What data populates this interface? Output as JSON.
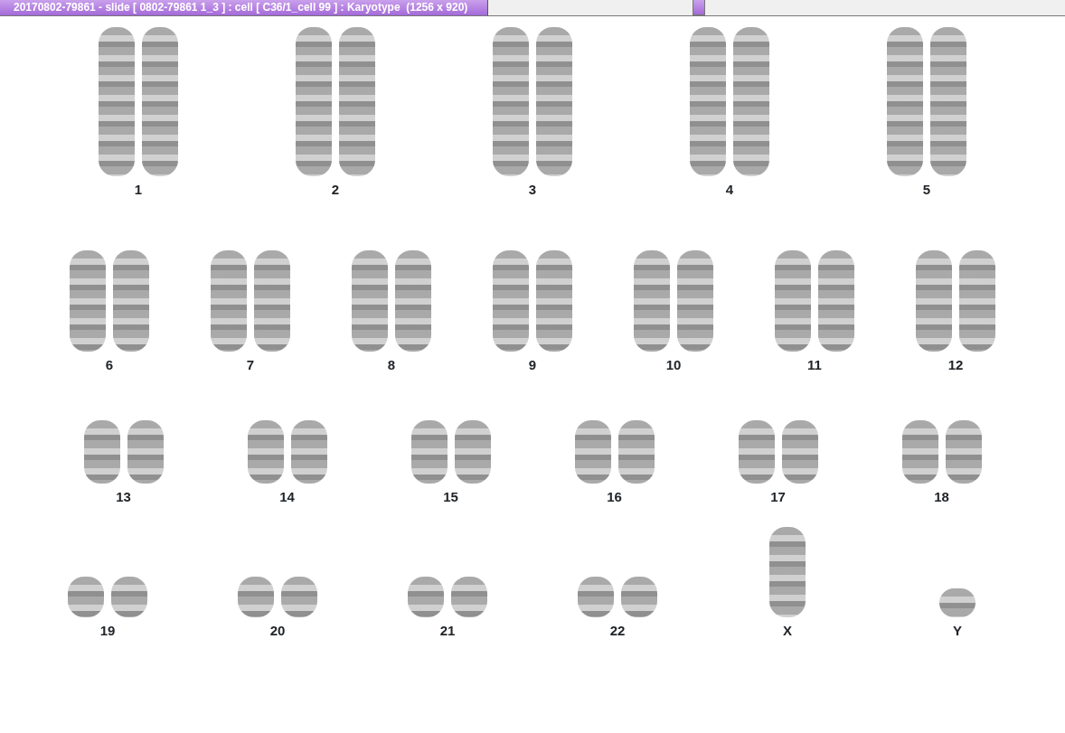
{
  "window": {
    "title": "20170802-79861 - slide [ 0802-79861 1_3 ] : cell [ C36/1_cell 99 ] : Karyotype  (1256 x 920)"
  },
  "karyotype": {
    "rows": [
      {
        "groups": [
          {
            "label": "1",
            "kind": "pair"
          },
          {
            "label": "2",
            "kind": "pair"
          },
          {
            "label": "3",
            "kind": "pair"
          },
          {
            "label": "4",
            "kind": "pair"
          },
          {
            "label": "5",
            "kind": "pair"
          }
        ]
      },
      {
        "groups": [
          {
            "label": "6",
            "kind": "pair"
          },
          {
            "label": "7",
            "kind": "pair"
          },
          {
            "label": "8",
            "kind": "pair"
          },
          {
            "label": "9",
            "kind": "pair"
          },
          {
            "label": "10",
            "kind": "pair"
          },
          {
            "label": "11",
            "kind": "pair"
          },
          {
            "label": "12",
            "kind": "pair"
          }
        ]
      },
      {
        "groups": [
          {
            "label": "13",
            "kind": "pair"
          },
          {
            "label": "14",
            "kind": "pair"
          },
          {
            "label": "15",
            "kind": "pair"
          },
          {
            "label": "16",
            "kind": "pair"
          },
          {
            "label": "17",
            "kind": "pair"
          },
          {
            "label": "18",
            "kind": "pair"
          }
        ]
      },
      {
        "groups": [
          {
            "label": "19",
            "kind": "pair"
          },
          {
            "label": "20",
            "kind": "pair"
          },
          {
            "label": "21",
            "kind": "pair"
          },
          {
            "label": "22",
            "kind": "pair"
          },
          {
            "label": "X",
            "kind": "single"
          },
          {
            "label": "Y",
            "kind": "single"
          }
        ]
      }
    ]
  }
}
